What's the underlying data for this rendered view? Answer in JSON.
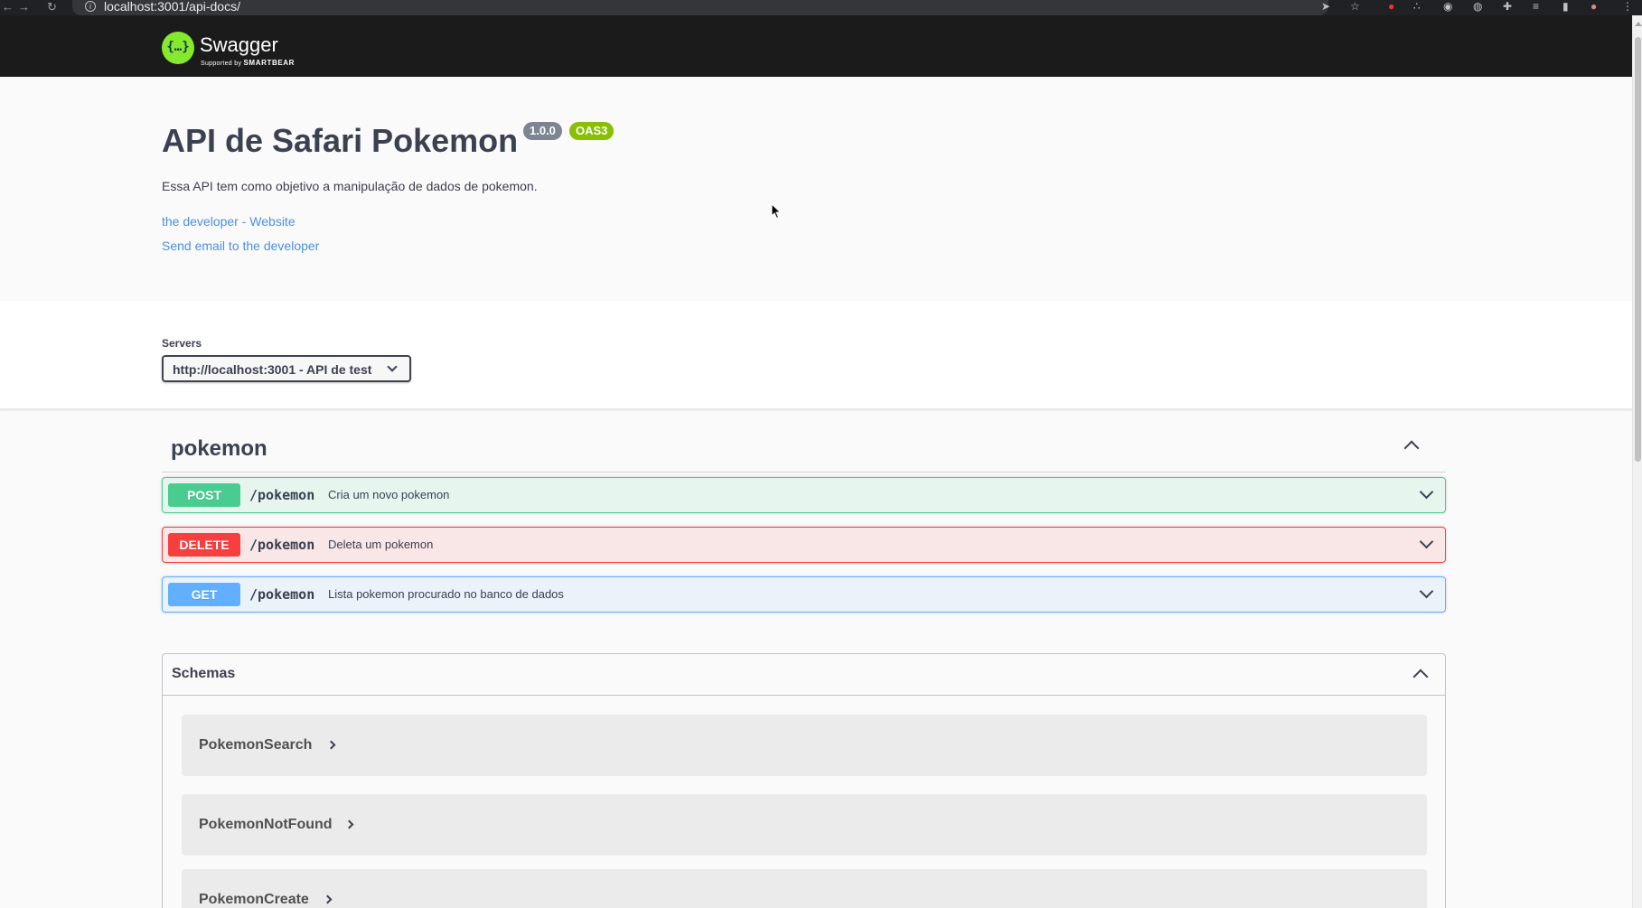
{
  "browser": {
    "url": "localhost:3001/api-docs/",
    "back_icon": "arrow-left-icon",
    "forward_icon": "arrow-right-icon",
    "reload_icon": "reload-icon"
  },
  "topbar": {
    "brand": "Swagger",
    "supported_by": "Supported by",
    "smartbear": "SMARTBEAR",
    "logo_glyph": "{…}",
    "color": "#1b1b1b",
    "logo_color": "#85ea2d"
  },
  "info": {
    "title": "API de Safari Pokemon",
    "version": "1.0.0",
    "oas": "OAS3",
    "description": "Essa API tem como objetivo a manipulação de dados de pokemon.",
    "website_link": "the developer - Website",
    "email_link": "Send email to the developer"
  },
  "servers": {
    "label": "Servers",
    "selected": "http://localhost:3001 - API de test"
  },
  "tag": {
    "name": "pokemon",
    "operations": [
      {
        "method": "POST",
        "path": "/pokemon",
        "summary": "Cria um novo pokemon",
        "color": "#49cc90"
      },
      {
        "method": "DELETE",
        "path": "/pokemon",
        "summary": "Deleta um pokemon",
        "color": "#f93e3e"
      },
      {
        "method": "GET",
        "path": "/pokemon",
        "summary": "Lista pokemon procurado no banco de dados",
        "color": "#61affe"
      }
    ]
  },
  "schemas": {
    "title": "Schemas",
    "models": [
      "PokemonSearch",
      "PokemonNotFound",
      "PokemonCreate"
    ]
  }
}
